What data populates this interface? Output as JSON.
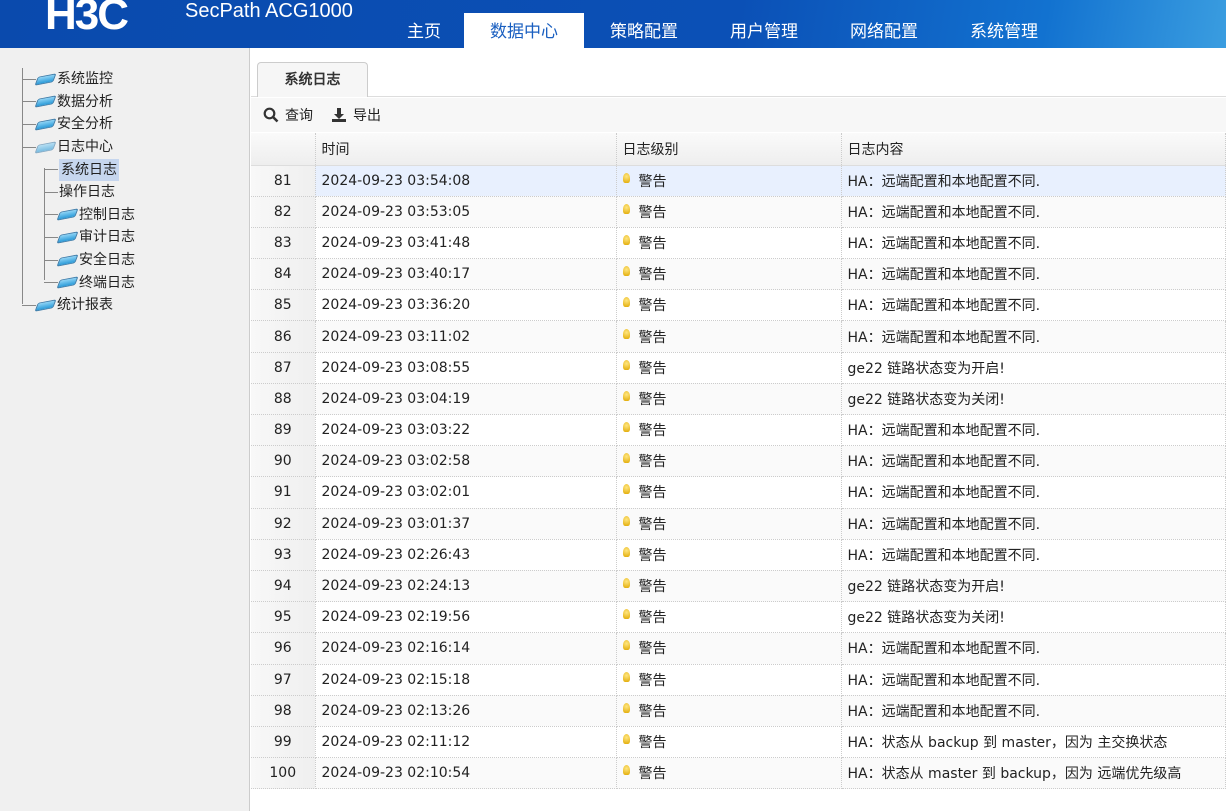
{
  "header": {
    "logo": "H3C",
    "product": "SecPath ACG1000",
    "nav": [
      "主页",
      "数据中心",
      "策略配置",
      "用户管理",
      "网络配置",
      "系统管理"
    ],
    "active_nav": "数据中心"
  },
  "sidebar": {
    "items": [
      "系统监控",
      "数据分析",
      "安全分析",
      "日志中心",
      "统计报表"
    ],
    "log_children": [
      "系统日志",
      "操作日志",
      "控制日志",
      "审计日志",
      "安全日志",
      "终端日志"
    ]
  },
  "tab": "系统日志",
  "toolbar": {
    "query": "查询",
    "export": "导出"
  },
  "table": {
    "headers": [
      "时间",
      "日志级别",
      "日志内容"
    ],
    "rows": [
      [
        "81",
        "2024-09-23 03:54:08",
        "警告",
        "HA：远端配置和本地配置不同."
      ],
      [
        "82",
        "2024-09-23 03:53:05",
        "警告",
        "HA：远端配置和本地配置不同."
      ],
      [
        "83",
        "2024-09-23 03:41:48",
        "警告",
        "HA：远端配置和本地配置不同."
      ],
      [
        "84",
        "2024-09-23 03:40:17",
        "警告",
        "HA：远端配置和本地配置不同."
      ],
      [
        "85",
        "2024-09-23 03:36:20",
        "警告",
        "HA：远端配置和本地配置不同."
      ],
      [
        "86",
        "2024-09-23 03:11:02",
        "警告",
        "HA：远端配置和本地配置不同."
      ],
      [
        "87",
        "2024-09-23 03:08:55",
        "警告",
        "ge22 链路状态变为开启!"
      ],
      [
        "88",
        "2024-09-23 03:04:19",
        "警告",
        "ge22 链路状态变为关闭!"
      ],
      [
        "89",
        "2024-09-23 03:03:22",
        "警告",
        "HA：远端配置和本地配置不同."
      ],
      [
        "90",
        "2024-09-23 03:02:58",
        "警告",
        "HA：远端配置和本地配置不同."
      ],
      [
        "91",
        "2024-09-23 03:02:01",
        "警告",
        "HA：远端配置和本地配置不同."
      ],
      [
        "92",
        "2024-09-23 03:01:37",
        "警告",
        "HA：远端配置和本地配置不同."
      ],
      [
        "93",
        "2024-09-23 02:26:43",
        "警告",
        "HA：远端配置和本地配置不同."
      ],
      [
        "94",
        "2024-09-23 02:24:13",
        "警告",
        "ge22 链路状态变为开启!"
      ],
      [
        "95",
        "2024-09-23 02:19:56",
        "警告",
        "ge22 链路状态变为关闭!"
      ],
      [
        "96",
        "2024-09-23 02:16:14",
        "警告",
        "HA：远端配置和本地配置不同."
      ],
      [
        "97",
        "2024-09-23 02:15:18",
        "警告",
        "HA：远端配置和本地配置不同."
      ],
      [
        "98",
        "2024-09-23 02:13:26",
        "警告",
        "HA：远端配置和本地配置不同."
      ],
      [
        "99",
        "2024-09-23 02:11:12",
        "警告",
        "HA：状态从 backup 到 master，因为 主交换状态"
      ],
      [
        "100",
        "2024-09-23 02:10:54",
        "警告",
        "HA：状态从 master 到 backup，因为 远端优先级高"
      ]
    ]
  }
}
